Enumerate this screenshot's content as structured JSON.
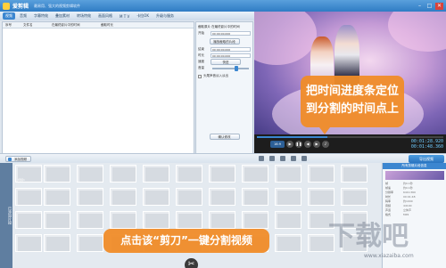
{
  "app": {
    "title": "爱剪辑",
    "subtitle": "最易用、强大的视频剪辑软件"
  },
  "window_controls": [
    "–",
    "□",
    "✕"
  ],
  "tabs": [
    "视频",
    "音频",
    "字幕特效",
    "叠加素材",
    "转场特效",
    "画面风格",
    "M T V",
    "卡拉OK",
    "升级与服务"
  ],
  "list": {
    "columns": [
      "序号",
      "文件名",
      "在最终影片中的时间",
      "截取时长"
    ],
    "footer_button": "删除",
    "confirm_button": "确认修改"
  },
  "settings": {
    "title": "截取原片 在最终影片中的时间",
    "rows": [
      {
        "label": "开始",
        "value": "00:00:00.000"
      },
      {
        "label": "结束",
        "value": "00:00:00.000"
      },
      {
        "label": "时长",
        "value": "00:00:00.000"
      }
    ],
    "buttons": [
      "播放截取的片段",
      "快进",
      "确认修改"
    ],
    "speed_label": "速度",
    "volume_label": "音量",
    "checkbox_label": "头尾声音淡入淡出"
  },
  "player": {
    "progress": 0.38,
    "ratio_label": "16:9",
    "time_current": "00:01:28.920",
    "time_total": "00:01:48.360"
  },
  "toolbar": {
    "add_video": "添加视频",
    "export": "导出视频"
  },
  "timeline": {
    "side_label": "已添加片段",
    "first_clip_name": "视频1"
  },
  "info_panel": {
    "title": "所有剪辑片段信息",
    "rows": [
      {
        "k": "帧",
        "v": "约0.1秒"
      },
      {
        "k": "帧速",
        "v": "约0.1秒"
      },
      {
        "k": "分辨率",
        "v": "640×360"
      },
      {
        "k": "时长",
        "v": "00:01:48"
      },
      {
        "k": "码率",
        "v": "约1000"
      },
      {
        "k": "音频",
        "v": "44100"
      },
      {
        "k": "声道",
        "v": "立体声"
      },
      {
        "k": "格式",
        "v": "MP4"
      }
    ]
  },
  "annotations": {
    "tip_progress_line1": "把时间进度条定位",
    "tip_progress_line2": "到分割的时间点上",
    "tip_scissors": "点击该“剪刀”一键分割视频"
  },
  "watermark": {
    "big": "下载吧",
    "url": "www.xiazaiba.com"
  },
  "colors": {
    "accent": "#3b86d0",
    "tip": "#f08c28",
    "titlebar": "#2f7cc4"
  }
}
